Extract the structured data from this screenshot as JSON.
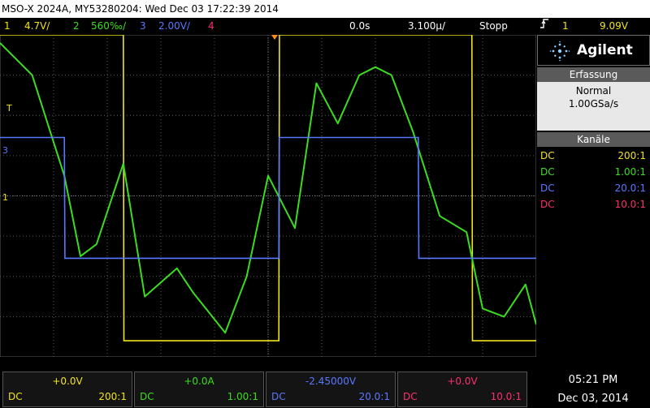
{
  "title": "MSO-X 2024A, MY53280204: Wed Dec 03 17:22:39 2014",
  "channels_bar": {
    "ch1_num": "1",
    "ch1_scale": "4.7V/",
    "ch2_num": "2",
    "ch2_scale": "560‰/",
    "ch3_num": "3",
    "ch3_scale": "2.00V/",
    "ch4_num": "4",
    "time_pos": "0.0s",
    "time_scale": "3.100µ/",
    "run_state": "Stopp",
    "trigger_icon": "trigger-edge-icon",
    "trigger_channel": "1",
    "trigger_level": "9.09V"
  },
  "brand": {
    "name": "Agilent"
  },
  "acquisition": {
    "header": "Erfassung",
    "mode": "Normal",
    "rate": "1.00GSa/s"
  },
  "channels_panel": {
    "header": "Kanäle",
    "rows": [
      {
        "coupling": "DC",
        "probe": "200:1",
        "color": "#f2e21e"
      },
      {
        "coupling": "DC",
        "probe": "1.00:1",
        "color": "#3cdc1e"
      },
      {
        "coupling": "DC",
        "probe": "20.0:1",
        "color": "#5a78ff"
      },
      {
        "coupling": "DC",
        "probe": "10.0:1",
        "color": "#ff2f6e"
      }
    ]
  },
  "bottom_channels": [
    {
      "offset": "+0.0V",
      "coupling": "DC",
      "probe": "200:1",
      "color": "#f2e21e"
    },
    {
      "offset": "+0.0A",
      "coupling": "DC",
      "probe": "1.00:1",
      "color": "#3cdc1e"
    },
    {
      "offset": "-2.45000V",
      "coupling": "DC",
      "probe": "20.0:1",
      "color": "#5a78ff"
    },
    {
      "offset": "+0.0V",
      "coupling": "DC",
      "probe": "10.0:1",
      "color": "#ff2f6e"
    }
  ],
  "clock": {
    "time": "05:21 PM",
    "date": "Dec 03, 2014"
  },
  "markers": {
    "trigger_T": "T",
    "ch3": "3",
    "ch1": "1"
  },
  "colors": {
    "ch1": "#f2e21e",
    "ch2": "#3cdc1e",
    "ch3": "#5a78ff",
    "ch4": "#ff2f6e",
    "grid": "#5a5a5a"
  },
  "chart_data": {
    "type": "line",
    "title": "",
    "xlabel": "",
    "ylabel": "",
    "series": [
      {
        "name": "1",
        "x": [
          0,
          1.2,
          2.3,
          2.31,
          4.0,
          5.2,
          5.21,
          8.8,
          8.81,
          10
        ],
        "y": [
          4.0,
          4.0,
          4.0,
          -3.6,
          -3.6,
          -3.6,
          4.0,
          4.0,
          -3.6,
          -3.6
        ]
      },
      {
        "name": "2",
        "x": [
          0,
          0.6,
          1.2,
          1.5,
          1.8,
          2.3,
          2.7,
          3.3,
          3.6,
          4.2,
          4.6,
          5.0,
          5.5,
          5.9,
          6.3,
          6.7,
          7.0,
          7.3,
          7.7,
          8.2,
          8.7,
          9.0,
          9.4,
          9.8,
          10.0
        ],
        "y": [
          3.8,
          3.0,
          0.5,
          -1.5,
          -1.2,
          0.8,
          -2.5,
          -1.8,
          -2.4,
          -3.4,
          -2.0,
          0.5,
          -0.8,
          2.8,
          1.8,
          3.0,
          3.2,
          3.0,
          1.6,
          -0.5,
          -0.9,
          -2.8,
          -3.0,
          -2.2,
          -3.2
        ]
      },
      {
        "name": "3",
        "x": [
          0,
          1.2,
          1.21,
          5.2,
          5.21,
          7.8,
          7.81,
          10
        ],
        "y": [
          1.45,
          1.45,
          -1.55,
          -1.55,
          1.45,
          1.45,
          -1.55,
          -1.55
        ]
      }
    ]
  }
}
